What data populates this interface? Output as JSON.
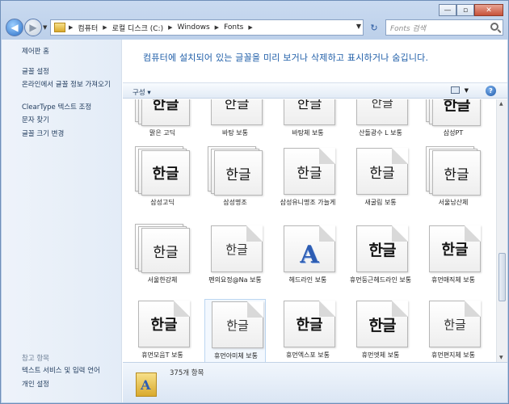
{
  "window": {
    "controls": [
      "—",
      "▫",
      "✕"
    ]
  },
  "address": {
    "crumbs": [
      "컴퓨터",
      "로컬 디스크 (C:)",
      "Windows",
      "Fonts"
    ],
    "search_placeholder": "Fonts 검색"
  },
  "sidebar": {
    "top_links": [
      "제어판 홈",
      "글꼴 설정",
      "온라인에서 글꼴 정보 가져오기",
      "ClearType 텍스트 조정",
      "문자 찾기",
      "글꼴 크기 변경"
    ],
    "see_also_heading": "참고 항목",
    "see_also_links": [
      "텍스트 서비스 및 입력 언어",
      "개인 설정"
    ]
  },
  "main": {
    "banner": "컴퓨터에 설치되어 있는 글꼴을 미리 보거나 삭제하고 표시하거나 숨깁니다.",
    "organize_label": "구성 ▾",
    "help_label": "?"
  },
  "fonts": [
    {
      "name": "맑은 고딕",
      "glyph": "한글",
      "style": "family",
      "weight": "bold"
    },
    {
      "name": "바탕 보통",
      "glyph": "한글",
      "style": "single",
      "weight": "serif"
    },
    {
      "name": "바탕체 보통",
      "glyph": "한글",
      "style": "single",
      "weight": "serif"
    },
    {
      "name": "산돌광수 L 보통",
      "glyph": "한글",
      "style": "single",
      "weight": "light"
    },
    {
      "name": "삼성PT",
      "glyph": "한글",
      "style": "family",
      "weight": "heavy"
    },
    {
      "name": "삼성고딕",
      "glyph": "한글",
      "style": "family",
      "weight": "bold"
    },
    {
      "name": "삼성명조",
      "glyph": "한글",
      "style": "family",
      "weight": "serif"
    },
    {
      "name": "삼성유니명조 가늘게",
      "glyph": "한글",
      "style": "single",
      "weight": "serif"
    },
    {
      "name": "새굴림 보통",
      "glyph": "한글",
      "style": "single",
      "weight": "normal"
    },
    {
      "name": "서울남산체",
      "glyph": "한글",
      "style": "family",
      "weight": "normal"
    },
    {
      "name": "서울한강체",
      "glyph": "한글",
      "style": "family",
      "weight": "serif"
    },
    {
      "name": "펜의요정@Na 보통",
      "glyph": "한글",
      "style": "single",
      "weight": "light"
    },
    {
      "name": "헤드라인 보통",
      "glyph": "A",
      "style": "single",
      "weight": "letter"
    },
    {
      "name": "휴먼둥근헤드라인 보통",
      "glyph": "한글",
      "style": "single",
      "weight": "heavy"
    },
    {
      "name": "휴먼매직체 보통",
      "glyph": "한글",
      "style": "single",
      "weight": "bold"
    },
    {
      "name": "휴먼모음T 보통",
      "glyph": "한글",
      "style": "single",
      "weight": "bold"
    },
    {
      "name": "휴먼아미체 보통",
      "glyph": "한글",
      "style": "single",
      "weight": "light"
    },
    {
      "name": "휴먼엑스포 보통",
      "glyph": "한글",
      "style": "single",
      "weight": "bold"
    },
    {
      "name": "휴먼엣체 보통",
      "glyph": "한글",
      "style": "single",
      "weight": "heavy"
    },
    {
      "name": "휴먼편지체 보통",
      "glyph": "한글",
      "style": "single",
      "weight": "light"
    }
  ],
  "status": {
    "item_count": "375개 항목"
  }
}
